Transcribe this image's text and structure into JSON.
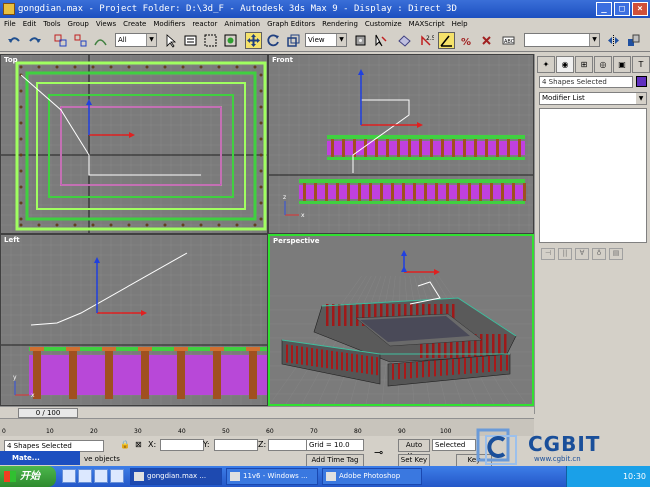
{
  "window": {
    "title": "gongdian.max - Project Folder: D:\\3d_F - Autodesk 3ds Max 9 - Display : Direct 3D",
    "minimize": "_",
    "maximize": "□",
    "close": "×"
  },
  "menu": [
    "File",
    "Edit",
    "Tools",
    "Group",
    "Views",
    "Create",
    "Modifiers",
    "reactor",
    "Animation",
    "Graph Editors",
    "Rendering",
    "Customize",
    "MAXScript",
    "Help"
  ],
  "toolbar": {
    "selection_filter": "All",
    "reference_coord": "View",
    "named_selection": ""
  },
  "viewports": {
    "top": "Top",
    "front": "Front",
    "left": "Left",
    "perspective": "Perspective",
    "axis_x": "x",
    "axis_y": "y",
    "axis_z": "z"
  },
  "command_panel": {
    "selection_name": "4 Shapes Selected",
    "modifier_list": "Modifier List"
  },
  "timeline": {
    "frame_display": "0 / 100",
    "ticks": [
      "0",
      "10",
      "20",
      "30",
      "40",
      "50",
      "60",
      "70",
      "80",
      "90",
      "100"
    ]
  },
  "status": {
    "selection": "4 Shapes Selected",
    "prompt": "ve objects",
    "x_label": "X:",
    "y_label": "Y:",
    "z_label": "Z:",
    "x_value": "",
    "y_value": "",
    "z_value": "",
    "grid": "Grid = 10.0",
    "auto_key": "Auto Key",
    "set_key": "Set Key",
    "selected": "Selected",
    "key_filters": "Key Filters...",
    "add_time_tag": "Add Time Tag"
  },
  "taskbar": {
    "start": "开始",
    "mate": "Mate...",
    "tasks": [
      "gongdian.max ...",
      "11v6 - Windows ...",
      "Adobe Photoshop"
    ],
    "clock": "10:30"
  },
  "watermark": {
    "brand": "CGBIT",
    "url": "www.cgbit.cn"
  },
  "colors": {
    "viewport_bg": "#7b7b7b",
    "active_border": "#30e030",
    "title_blue": "#1c4fc0"
  }
}
